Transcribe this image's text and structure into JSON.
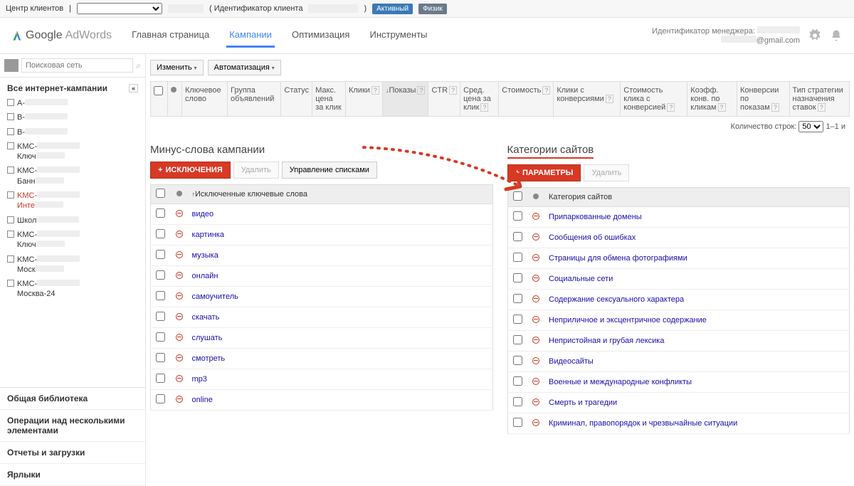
{
  "topbar": {
    "client_center": "Центр клиентов",
    "client_id_label": "( Идентификатор клиента",
    "client_id_paren": ")",
    "badge_active": "Активный",
    "badge_phys": "Физик"
  },
  "header": {
    "logo_g": "Google",
    "logo_aw": "AdWords",
    "manager_label": "Идентификатор менеджера:",
    "email": "@gmail.com"
  },
  "nav": {
    "home": "Главная страница",
    "campaigns": "Кампании",
    "optimization": "Оптимизация",
    "tools": "Инструменты"
  },
  "sidebar": {
    "search_placeholder": "Поисковая сеть",
    "all_campaigns": "Все интернет-кампании",
    "items": [
      {
        "label": "А-",
        "type": "paused"
      },
      {
        "label": "В-",
        "type": "paused"
      },
      {
        "label": "В-",
        "type": "paused"
      },
      {
        "label": "KMC-",
        "sub": "Ключ",
        "type": "folder"
      },
      {
        "label": "KMC-",
        "sub": "Банн",
        "type": "folder"
      },
      {
        "label": "KMC-",
        "sub": "Инте",
        "type": "folder",
        "active": true
      },
      {
        "label": "Школ",
        "type": "item"
      },
      {
        "label": "KMC-",
        "sub": "Ключ",
        "type": "folder"
      },
      {
        "label": "KMC-",
        "sub": "Моск",
        "type": "folder"
      },
      {
        "label": "KMC-",
        "sub": "Москва-24",
        "type": "folder"
      }
    ],
    "bottom": [
      "Общая библиотека",
      "Операции над несколькими элементами",
      "Отчеты и загрузки",
      "Ярлыки"
    ]
  },
  "toolbar": {
    "edit": "Изменить",
    "automation": "Автоматизация"
  },
  "columns": [
    "Ключевое слово",
    "Группа объявлений",
    "Статус",
    "Макс. цена за клик",
    "Клики",
    "Показы",
    "CTR",
    "Сред. цена за клик",
    "Стоимость",
    "Клики с конверсиями",
    "Стоимость клика с конверсией",
    "Коэфф. конв. по кликам",
    "Конверсии по показам",
    "Тип стратегии назначения ставок"
  ],
  "pagination": {
    "rows_label": "Количество строк:",
    "rows": "50",
    "range": "1–1 и"
  },
  "negkw": {
    "title": "Минус-слова кампании",
    "btn_add": "ИСКЛЮЧЕНИЯ",
    "btn_del": "Удалить",
    "btn_lists": "Управление списками",
    "header": "Исключенные ключевые слова",
    "rows": [
      "видео",
      "картинка",
      "музыка",
      "онлайн",
      "самоучитель",
      "скачать",
      "слушать",
      "смотреть",
      "mp3",
      "online"
    ]
  },
  "categories": {
    "title": "Категории сайтов",
    "btn_add": "ПАРАМЕТРЫ",
    "btn_del": "Удалить",
    "header": "Категория сайтов",
    "rows": [
      "Припаркованные домены",
      "Сообщения об ошибках",
      "Страницы для обмена фотографиями",
      "Социальные сети",
      "Содержание сексуального характера",
      "Неприличное и эксцентричное содержание",
      "Непристойная и грубая лексика",
      "Видеосайты",
      "Военные и международные конфликты",
      "Смерть и трагедии",
      "Криминал, правопорядок и чрезвычайные ситуации"
    ]
  }
}
